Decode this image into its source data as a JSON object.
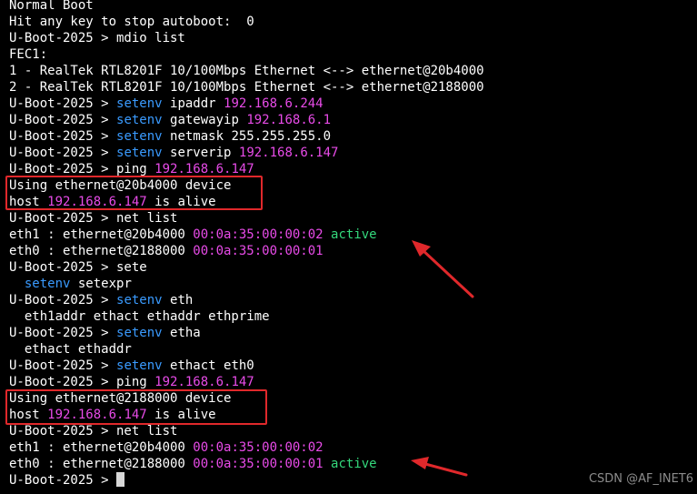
{
  "terminal": {
    "lines": [
      [
        {
          "t": "Normal Boot",
          "c": "w"
        }
      ],
      [
        {
          "t": "Hit any key to stop autoboot:  0",
          "c": "w"
        }
      ],
      [
        {
          "t": "U-Boot-2025 > mdio list",
          "c": "w"
        }
      ],
      [
        {
          "t": "FEC1:",
          "c": "w"
        }
      ],
      [
        {
          "t": "1 - RealTek RTL8201F 10/100Mbps Ethernet <--> ethernet@20b4000",
          "c": "w"
        }
      ],
      [
        {
          "t": "2 - RealTek RTL8201F 10/100Mbps Ethernet <--> ethernet@2188000",
          "c": "w"
        }
      ],
      [
        {
          "t": "U-Boot-2025 > ",
          "c": "w"
        },
        {
          "t": "setenv",
          "c": "c"
        },
        {
          "t": " ipaddr ",
          "c": "w"
        },
        {
          "t": "192.168.6.244",
          "c": "m"
        }
      ],
      [
        {
          "t": "U-Boot-2025 > ",
          "c": "w"
        },
        {
          "t": "setenv",
          "c": "c"
        },
        {
          "t": " gatewayip ",
          "c": "w"
        },
        {
          "t": "192.168.6.1",
          "c": "m"
        }
      ],
      [
        {
          "t": "U-Boot-2025 > ",
          "c": "w"
        },
        {
          "t": "setenv",
          "c": "c"
        },
        {
          "t": " netmask 255.255.255.0",
          "c": "w"
        }
      ],
      [
        {
          "t": "U-Boot-2025 > ",
          "c": "w"
        },
        {
          "t": "setenv",
          "c": "c"
        },
        {
          "t": " serverip ",
          "c": "w"
        },
        {
          "t": "192.168.6.147",
          "c": "m"
        }
      ],
      [
        {
          "t": "U-Boot-2025 > ping ",
          "c": "w"
        },
        {
          "t": "192.168.6.147",
          "c": "m"
        }
      ],
      [
        {
          "t": "Using ethernet@20b4000 device",
          "c": "w"
        }
      ],
      [
        {
          "t": "host ",
          "c": "w"
        },
        {
          "t": "192.168.6.147",
          "c": "m"
        },
        {
          "t": " is alive",
          "c": "w"
        }
      ],
      [
        {
          "t": "U-Boot-2025 > net list",
          "c": "w"
        }
      ],
      [
        {
          "t": "eth1 : ethernet@20b4000 ",
          "c": "w"
        },
        {
          "t": "00:0a:35:00:00:02",
          "c": "m"
        },
        {
          "t": " ",
          "c": "w"
        },
        {
          "t": "active",
          "c": "g"
        }
      ],
      [
        {
          "t": "eth0 : ethernet@2188000 ",
          "c": "w"
        },
        {
          "t": "00:0a:35:00:00:01",
          "c": "m"
        }
      ],
      [
        {
          "t": "U-Boot-2025 > sete",
          "c": "w"
        }
      ],
      [
        {
          "t": "  ",
          "c": "w"
        },
        {
          "t": "setenv",
          "c": "c"
        },
        {
          "t": " setexpr",
          "c": "w"
        }
      ],
      [
        {
          "t": "U-Boot-2025 > ",
          "c": "w"
        },
        {
          "t": "setenv",
          "c": "c"
        },
        {
          "t": " eth",
          "c": "w"
        }
      ],
      [
        {
          "t": "  eth1addr ethact ethaddr ethprime",
          "c": "w"
        }
      ],
      [
        {
          "t": "U-Boot-2025 > ",
          "c": "w"
        },
        {
          "t": "setenv",
          "c": "c"
        },
        {
          "t": " etha",
          "c": "w"
        }
      ],
      [
        {
          "t": "  ethact ethaddr",
          "c": "w"
        }
      ],
      [
        {
          "t": "U-Boot-2025 > ",
          "c": "w"
        },
        {
          "t": "setenv",
          "c": "c"
        },
        {
          "t": " ethact eth0",
          "c": "w"
        }
      ],
      [
        {
          "t": "U-Boot-2025 > ping ",
          "c": "w"
        },
        {
          "t": "192.168.6.147",
          "c": "m"
        }
      ],
      [
        {
          "t": "Using ethernet@2188000 device",
          "c": "w"
        }
      ],
      [
        {
          "t": "host ",
          "c": "w"
        },
        {
          "t": "192.168.6.147",
          "c": "m"
        },
        {
          "t": " is alive",
          "c": "w"
        }
      ],
      [
        {
          "t": "U-Boot-2025 > net list",
          "c": "w"
        }
      ],
      [
        {
          "t": "eth1 : ethernet@20b4000 ",
          "c": "w"
        },
        {
          "t": "00:0a:35:00:00:02",
          "c": "m"
        }
      ],
      [
        {
          "t": "eth0 : ethernet@2188000 ",
          "c": "w"
        },
        {
          "t": "00:0a:35:00:00:01",
          "c": "m"
        },
        {
          "t": " ",
          "c": "w"
        },
        {
          "t": "active",
          "c": "g"
        }
      ],
      [
        {
          "t": "U-Boot-2025 > ",
          "c": "w"
        }
      ]
    ]
  },
  "watermark": "CSDN @AF_INET6",
  "colors": {
    "background": "#000000",
    "text": "#ffffff",
    "ip_mac": "#e84be8",
    "command": "#3a9bff",
    "active": "#34d87c",
    "annotation": "#e0282b"
  }
}
